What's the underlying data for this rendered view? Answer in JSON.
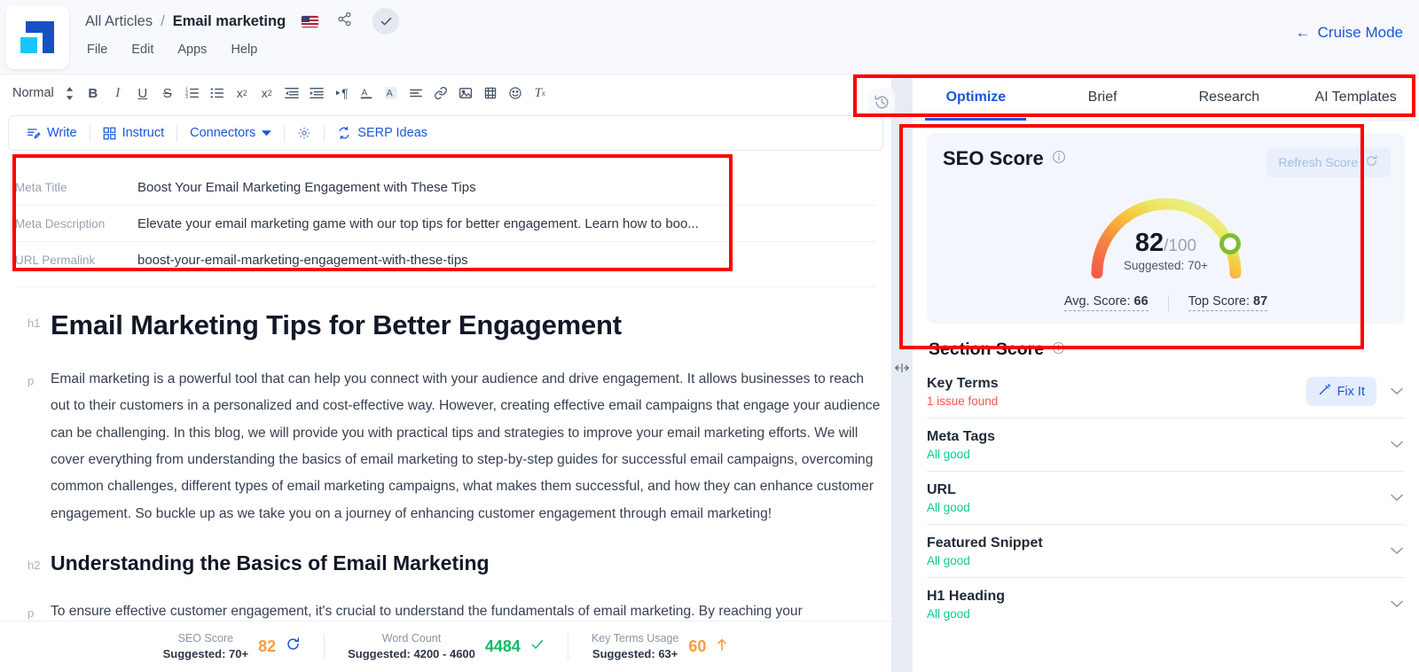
{
  "header": {
    "breadcrumb_root": "All Articles",
    "breadcrumb_sep": "/",
    "breadcrumb_current": "Email marketing",
    "flag_icon": "us-flag-icon",
    "share_icon": "share-icon",
    "check_icon": "check-icon",
    "menus": [
      "File",
      "Edit",
      "Apps",
      "Help"
    ],
    "cruise_mode": "Cruise Mode",
    "cruise_arrow": "←"
  },
  "toolbar": {
    "style_label": "Normal",
    "buttons": [
      {
        "name": "style-updown-icon",
        "glyph": "⇕"
      },
      {
        "name": "bold-icon",
        "glyph": "B"
      },
      {
        "name": "italic-icon",
        "glyph": "I"
      },
      {
        "name": "underline-icon",
        "glyph": "U"
      },
      {
        "name": "strikethrough-icon",
        "glyph": "S"
      },
      {
        "name": "ordered-list-icon",
        "glyph": "list-ol"
      },
      {
        "name": "bullet-list-icon",
        "glyph": "list-ul"
      },
      {
        "name": "subscript-icon",
        "glyph": "x₂"
      },
      {
        "name": "superscript-icon",
        "glyph": "x²"
      },
      {
        "name": "outdent-icon",
        "glyph": "outdent"
      },
      {
        "name": "indent-icon",
        "glyph": "indent"
      },
      {
        "name": "text-direction-icon",
        "glyph": "¶"
      },
      {
        "name": "text-color-icon",
        "glyph": "A"
      },
      {
        "name": "highlight-color-icon",
        "glyph": "A-shaded"
      },
      {
        "name": "align-icon",
        "glyph": "align"
      },
      {
        "name": "link-icon",
        "glyph": "link"
      },
      {
        "name": "image-icon",
        "glyph": "image"
      },
      {
        "name": "video-icon",
        "glyph": "video"
      },
      {
        "name": "emoji-icon",
        "glyph": "☺"
      },
      {
        "name": "clear-format-icon",
        "glyph": "Tx"
      }
    ]
  },
  "ai_bar": {
    "items": [
      {
        "label": "Write",
        "icon": "write-icon",
        "dropdown": false
      },
      {
        "label": "Instruct",
        "icon": "instruct-icon",
        "dropdown": false
      },
      {
        "label": "Connectors",
        "icon": "",
        "dropdown": true
      },
      {
        "label": "",
        "icon": "gear-icon",
        "dropdown": false
      },
      {
        "label": "SERP Ideas",
        "icon": "serp-icon",
        "dropdown": false
      }
    ]
  },
  "meta": {
    "rows": [
      {
        "label": "Meta Title",
        "value": "Boost Your Email Marketing Engagement with These Tips"
      },
      {
        "label": "Meta Description",
        "value": "Elevate your email marketing game with our top tips for better engagement. Learn how to boo..."
      },
      {
        "label": "URL Permalink",
        "value": "boost-your-email-marketing-engagement-with-these-tips"
      }
    ]
  },
  "article": {
    "blocks": [
      {
        "tag": "h1",
        "text": "Email Marketing Tips for Better Engagement"
      },
      {
        "tag": "p",
        "text": "Email marketing is a powerful tool that can help you connect with your audience and drive engagement. It allows businesses to reach out to their customers in a personalized and cost-effective way. However, creating effective email campaigns that engage your audience can be challenging. In this blog, we will provide you with practical tips and strategies to improve your email marketing efforts. We will cover everything from understanding the basics of email marketing to step-by-step guides for successful email campaigns, overcoming common challenges, different types of email marketing campaigns, what makes them successful, and how they can enhance customer engagement. So buckle up as we take you on a journey of enhancing customer engagement through email marketing!"
      },
      {
        "tag": "h2",
        "text": "Understanding the Basics of Email Marketing"
      },
      {
        "tag": "p",
        "text": "To ensure effective customer engagement, it's crucial to understand the fundamentals of email marketing. By reaching your"
      }
    ]
  },
  "statusbar": {
    "items": [
      {
        "name": "SEO Score",
        "suggested": "Suggested: 70+",
        "value": "82",
        "value_color": "#f5a03c",
        "icon": "refresh-icon",
        "icon_color": "#1a56db"
      },
      {
        "name": "Word Count",
        "suggested": "Suggested: 4200 - 4600",
        "value": "4484",
        "value_color": "#16b866",
        "icon": "check-icon",
        "icon_color": "#16b866"
      },
      {
        "name": "Key Terms Usage",
        "suggested": "Suggested: 63+",
        "value": "60",
        "value_color": "#f5a03c",
        "icon": "up-arrow-icon",
        "icon_color": "#f5a03c"
      }
    ]
  },
  "right_panel": {
    "history_icon": "history-icon",
    "resize_handle_icon": "resize-handle-icon",
    "tabs": [
      {
        "label": "Optimize",
        "active": true
      },
      {
        "label": "Brief",
        "active": false
      },
      {
        "label": "Research",
        "active": false
      },
      {
        "label": "AI Templates",
        "active": false
      }
    ],
    "seo_card": {
      "title": "SEO Score",
      "info_icon": "info-icon",
      "refresh_label": "Refresh Score",
      "refresh_icon": "refresh-icon",
      "score": "82",
      "score_suffix": "/100",
      "suggested": "Suggested: 70+",
      "avg_label": "Avg. Score:",
      "avg_value": "66",
      "top_label": "Top Score:",
      "top_value": "87"
    },
    "section_score": {
      "title": "Section Score",
      "info_icon": "info-icon",
      "rows": [
        {
          "name": "Key Terms",
          "status": "1 issue found",
          "status_type": "bad",
          "action": "Fix It",
          "action_icon": "magic-wand-icon"
        },
        {
          "name": "Meta Tags",
          "status": "All good",
          "status_type": "ok",
          "action": null
        },
        {
          "name": "URL",
          "status": "All good",
          "status_type": "ok",
          "action": null
        },
        {
          "name": "Featured Snippet",
          "status": "All good",
          "status_type": "ok",
          "action": null
        },
        {
          "name": "H1 Heading",
          "status": "All good",
          "status_type": "ok",
          "action": null
        }
      ]
    }
  },
  "colors": {
    "accent": "#1a56db",
    "good": "#10c98f",
    "bad": "#f2584a",
    "warn": "#f5a03c",
    "annotation": "#ff0000"
  }
}
